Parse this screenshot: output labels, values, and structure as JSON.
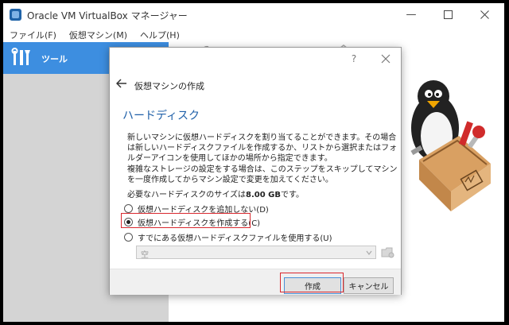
{
  "window": {
    "title": "Oracle VM VirtualBox マネージャー",
    "minimize_glyph": "—",
    "accent_color": "#3d8ee0"
  },
  "menubar": {
    "items": [
      "ファイル(F)",
      "仮想マシン(M)",
      "ヘルプ(H)"
    ]
  },
  "sidebar": {
    "tools_label": "ツール",
    "tools_icon": "tools-icon"
  },
  "dialog": {
    "help_glyph": "?",
    "title": "仮想マシンの作成",
    "page_header": "ハードディスク",
    "description_1": "新しいマシンに仮想ハードディスクを割り当てることができます。その場合は新しいハードディスクファイルを作成するか、リストから選択またはフォルダーアイコンを使用してほかの場所から指定できます。",
    "description_2": "複雑なストレージの設定をする場合は、このステップをスキップしてマシンを一度作成してからマシン設定で変更を加えてください。",
    "size_prefix": "必要なハードディスクのサイズは",
    "size_value": "8.00 GB",
    "size_suffix": "です。",
    "options": [
      {
        "label": "仮想ハードディスクを追加しない(D)",
        "checked": false
      },
      {
        "label": "仮想ハードディスクを作成する(C)",
        "checked": true
      },
      {
        "label": "すでにある仮想ハードディスクファイルを使用する(U)",
        "checked": false
      }
    ],
    "file_select_value": "空",
    "create_button": "作成",
    "cancel_button": "キャンセル",
    "highlight_color": "#d9282e"
  }
}
